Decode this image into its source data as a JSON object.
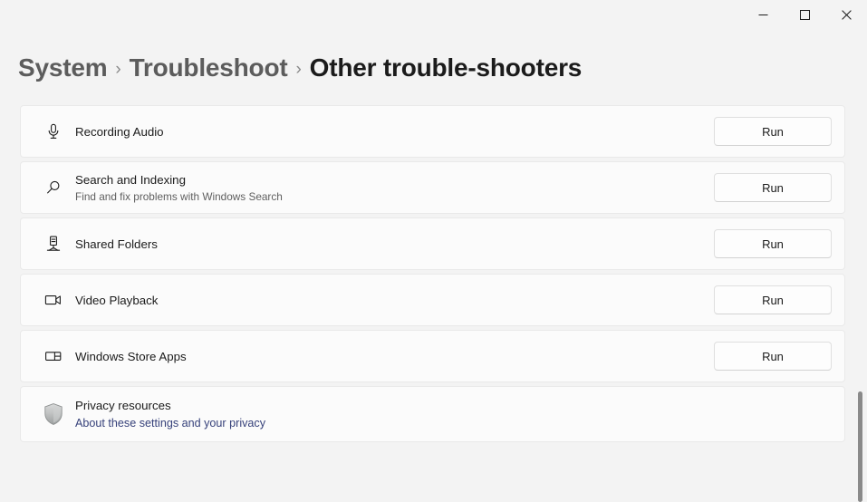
{
  "window": {
    "controls": [
      {
        "name": "minimize",
        "glyph": "minimize-icon",
        "label": "Minimize"
      },
      {
        "name": "maximize",
        "glyph": "maximize-icon",
        "label": "Maximize"
      },
      {
        "name": "close",
        "glyph": "close-icon",
        "label": "Close"
      }
    ]
  },
  "breadcrumb": {
    "items": [
      {
        "label": "System",
        "current": false
      },
      {
        "label": "Troubleshoot",
        "current": false
      },
      {
        "label": "Other trouble-shooters",
        "current": true
      }
    ],
    "separator": "›"
  },
  "colors": {
    "page_background": "#f3f3f3",
    "card_background": "#fbfbfb",
    "card_border": "#e9e9e9",
    "text_primary": "#1b1b1b",
    "text_secondary": "#5f5f5f",
    "breadcrumb_link": "#5c5c5c",
    "link": "#36417a",
    "scrollbar_thumb": "#8a8a8a"
  },
  "troubleshooters": [
    {
      "icon": "microphone-icon",
      "title": "Recording Audio",
      "subtitle": "",
      "action_label": "Run"
    },
    {
      "icon": "search-icon",
      "title": "Search and Indexing",
      "subtitle": "Find and fix problems with Windows Search",
      "action_label": "Run"
    },
    {
      "icon": "shared-folders-icon",
      "title": "Shared Folders",
      "subtitle": "",
      "action_label": "Run"
    },
    {
      "icon": "video-camera-icon",
      "title": "Video Playback",
      "subtitle": "",
      "action_label": "Run"
    },
    {
      "icon": "store-apps-icon",
      "title": "Windows Store Apps",
      "subtitle": "",
      "action_label": "Run"
    }
  ],
  "privacy": {
    "icon": "shield-icon",
    "title": "Privacy resources",
    "link_label": "About these settings and your privacy"
  }
}
